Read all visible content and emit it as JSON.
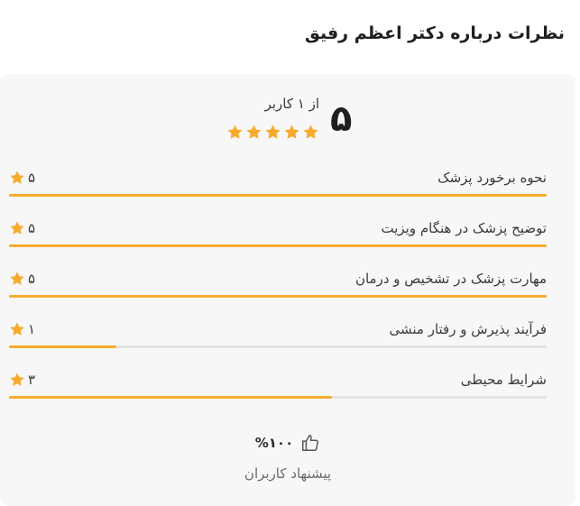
{
  "page": {
    "title": "نظرات درباره دکتر اعظم رفیق"
  },
  "summary": {
    "score": "۵",
    "count_text": "از ۱ کاربر",
    "stars": 5,
    "star_color": "#f6ab2f"
  },
  "criteria": [
    {
      "label": "نحوه برخورد پزشک",
      "value": "۵",
      "fill": 1.0
    },
    {
      "label": "توضیح پزشک در هنگام ویزیت",
      "value": "۵",
      "fill": 1.0
    },
    {
      "label": "مهارت پزشک در تشخیص و درمان",
      "value": "۵",
      "fill": 1.0
    },
    {
      "label": "فرآیند پذیرش و رفتار منشی",
      "value": "۱",
      "fill": 0.2
    },
    {
      "label": "شرایط محیطی",
      "value": "۳",
      "fill": 0.6
    }
  ],
  "recommend": {
    "percent": "%۱۰۰",
    "label": "پیشنهاد کاربران",
    "icon": "thumbs-up-icon"
  },
  "colors": {
    "accent": "#f6ab2f",
    "track": "#e3e3e3",
    "card_bg": "#f7f7f7"
  }
}
